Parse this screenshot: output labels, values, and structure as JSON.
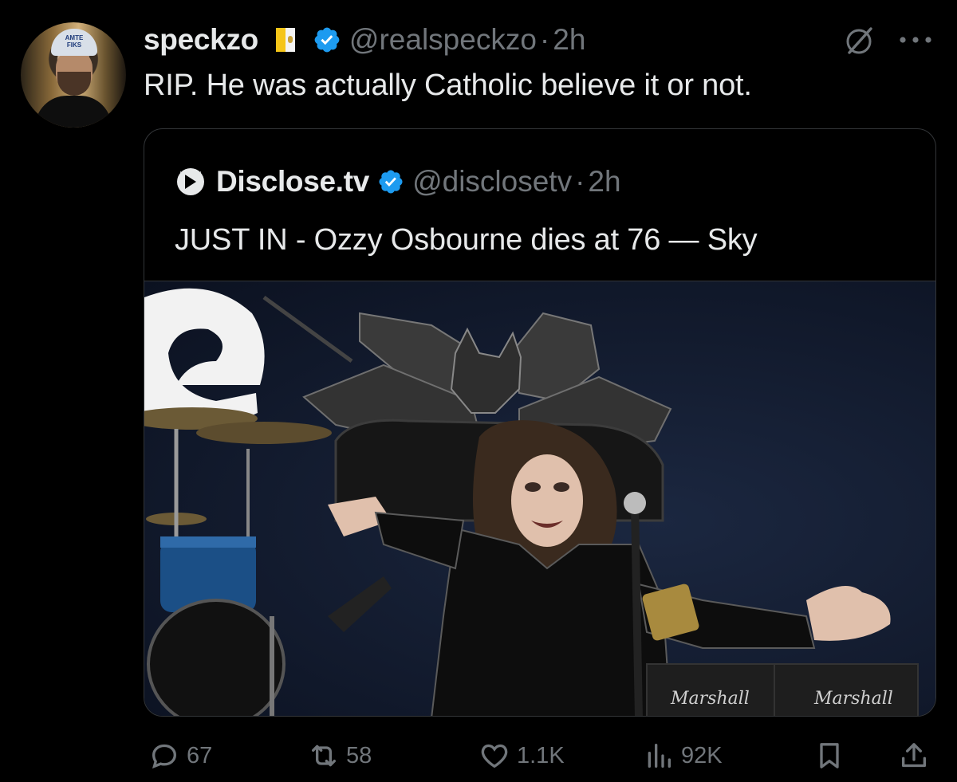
{
  "tweet": {
    "display_name": "speckzo",
    "flag_icon": "vatican-flag-icon",
    "handle": "@realspeckzo",
    "separator": "·",
    "time": "2h",
    "text": "RIP. He was actually Catholic believe it or not.",
    "avatar_cap_text": "AMTE FIKS"
  },
  "quote": {
    "name": "Disclose.tv",
    "handle": "@disclosetv",
    "separator": "·",
    "time": "2h",
    "text": "JUST IN - Ozzy Osbourne dies at 76 — Sky",
    "image_stage_text": "Marshall"
  },
  "actions": {
    "replies": "67",
    "reposts": "58",
    "likes": "1.1K",
    "views": "92K"
  },
  "colors": {
    "background": "#000000",
    "text_primary": "#e7e9ea",
    "text_secondary": "#71767b",
    "verified_blue": "#1d9bf0",
    "border": "#333639"
  },
  "icons": [
    "reply-icon",
    "repost-icon",
    "like-icon",
    "views-icon",
    "bookmark-icon",
    "share-icon",
    "grok-icon",
    "more-icon",
    "verified-badge-icon"
  ]
}
